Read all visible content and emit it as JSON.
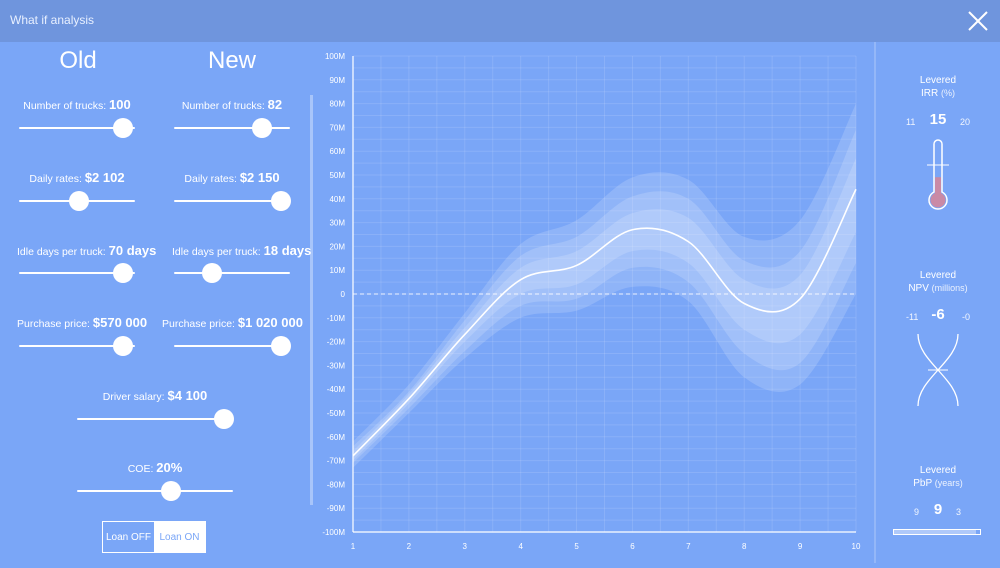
{
  "app": {
    "title": "What if analysis"
  },
  "columns": {
    "old": "Old",
    "new": "New"
  },
  "old": {
    "trucks": {
      "label": "Number of trucks:",
      "value": "100",
      "level": 0.9
    },
    "rates": {
      "label": "Daily rates:",
      "value": "$2 102",
      "level": 0.52
    },
    "idle": {
      "label": "Idle days per truck:",
      "value": "70 days",
      "level": 0.9
    },
    "price": {
      "label": "Purchase price:",
      "value": "$570 000",
      "level": 0.9
    }
  },
  "new": {
    "trucks": {
      "label": "Number of trucks:",
      "value": "82",
      "level": 0.76
    },
    "rates": {
      "label": "Daily rates:",
      "value": "$2 150",
      "level": 0.92
    },
    "idle": {
      "label": "Idle days per truck:",
      "value": "18 days",
      "level": 0.33
    },
    "price": {
      "label": "Purchase price:",
      "value": "$1 020 000",
      "level": 0.92
    }
  },
  "shared": {
    "driver": {
      "label": "Driver salary:",
      "value": "$4 100",
      "level": 0.94
    },
    "coe": {
      "label": "COE:",
      "value": "20%",
      "level": 0.6
    }
  },
  "loan": {
    "off": "Loan OFF",
    "on": "Loan ON",
    "selected": "on"
  },
  "metrics": {
    "irr": {
      "title": "Levered",
      "name": "IRR",
      "unit": "(%)",
      "min": "11",
      "value": "15",
      "max": "20",
      "level": 0.4
    },
    "npv": {
      "title": "Levered",
      "name": "NPV",
      "unit": "(millions)",
      "min": "-11",
      "value": "-6",
      "max": "-0"
    },
    "pbp": {
      "title": "Levered",
      "name": "PbP",
      "unit": "(years)",
      "min": "9",
      "value": "9",
      "max": "3",
      "level": 0.95
    }
  },
  "colors": {
    "background": "#7aa6f7",
    "header": "#6f95dd",
    "thermo_fill": "#c98aa6"
  },
  "chart_data": {
    "type": "line",
    "x": [
      1,
      2,
      3,
      4,
      5,
      6,
      7,
      8,
      9,
      10
    ],
    "xticks": [
      "1",
      "2",
      "3",
      "4",
      "5",
      "6",
      "7",
      "8",
      "9",
      "10"
    ],
    "yticks": [
      "100M",
      "90M",
      "80M",
      "70M",
      "60M",
      "50M",
      "40M",
      "30M",
      "20M",
      "10M",
      "0",
      "-10M",
      "-20M",
      "-30M",
      "-40M",
      "-50M",
      "-60M",
      "-70M",
      "-80M",
      "-90M",
      "-100M"
    ],
    "ylim": [
      -100,
      100
    ],
    "zero_line": "dashed",
    "grid": true,
    "series": [
      {
        "values": [
          -68,
          -44,
          -17,
          6,
          12,
          27,
          22,
          -4,
          -2,
          44
        ]
      }
    ],
    "bands": [
      {
        "lower": [
          -73,
          -50,
          -27,
          -10,
          -7,
          3,
          -3,
          -35,
          -38,
          0
        ],
        "upper": [
          -62,
          -38,
          -8,
          21,
          31,
          49,
          48,
          24,
          31,
          80
        ]
      },
      {
        "lower": [
          -71,
          -48,
          -24,
          -5,
          -2,
          11,
          5,
          -25,
          -29,
          13
        ],
        "upper": [
          -64,
          -41,
          -11,
          16,
          24,
          41,
          40,
          14,
          18,
          69
        ]
      },
      {
        "lower": [
          -70,
          -46,
          -20,
          0,
          4,
          18,
          13,
          -15,
          -17,
          26
        ],
        "upper": [
          -66,
          -42,
          -14,
          11,
          18,
          34,
          32,
          6,
          8,
          57
        ]
      }
    ]
  }
}
